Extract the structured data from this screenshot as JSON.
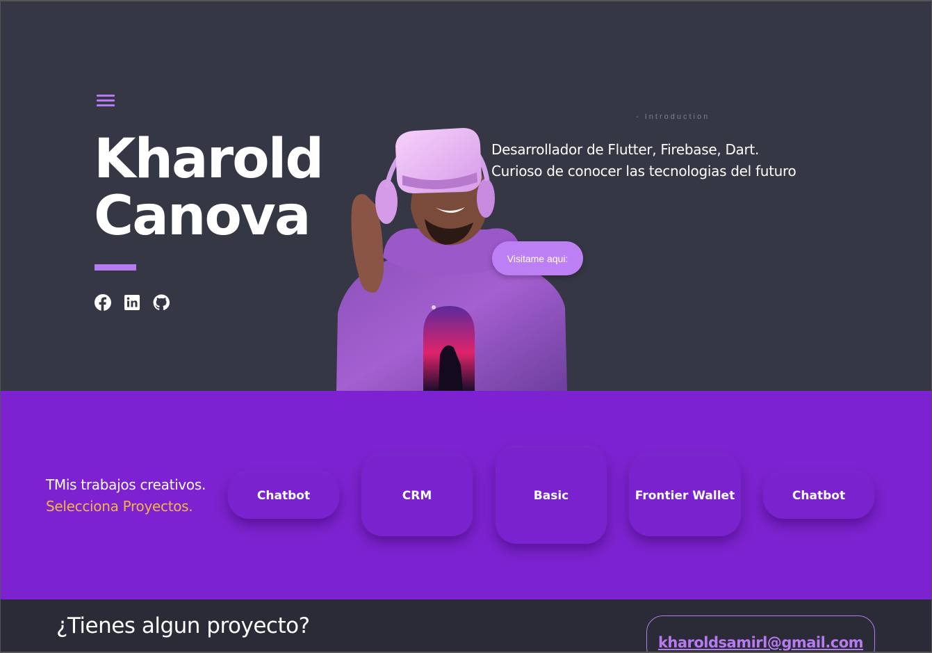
{
  "hero": {
    "name_line1": "Kharold",
    "name_line2": "Canova",
    "intro_label": "- Introduction",
    "tagline_line1": "Desarrollador de Flutter, Firebase, Dart.",
    "tagline_line2": "Curioso de conocer las tecnologias del futuro",
    "visit_button": "Visitame aqui:",
    "socials": [
      "facebook-icon",
      "linkedin-icon",
      "github-icon"
    ]
  },
  "projects": {
    "line1": "TMis trabajos creativos.",
    "line2": "Selecciona Proyectos.",
    "cards": [
      "Chatbot",
      "CRM",
      "Basic",
      "Frontier Wallet",
      "Chatbot"
    ]
  },
  "contact": {
    "question": "¿Tienes algun proyecto?",
    "email": "kharoldsamirl@gmail.com"
  },
  "colors": {
    "hero_bg": "#353745",
    "accent_purple": "#b77bf0",
    "projects_bg": "#7d22d0",
    "highlight_orange": "#f3b44c",
    "contact_bg": "#2a2b36"
  }
}
